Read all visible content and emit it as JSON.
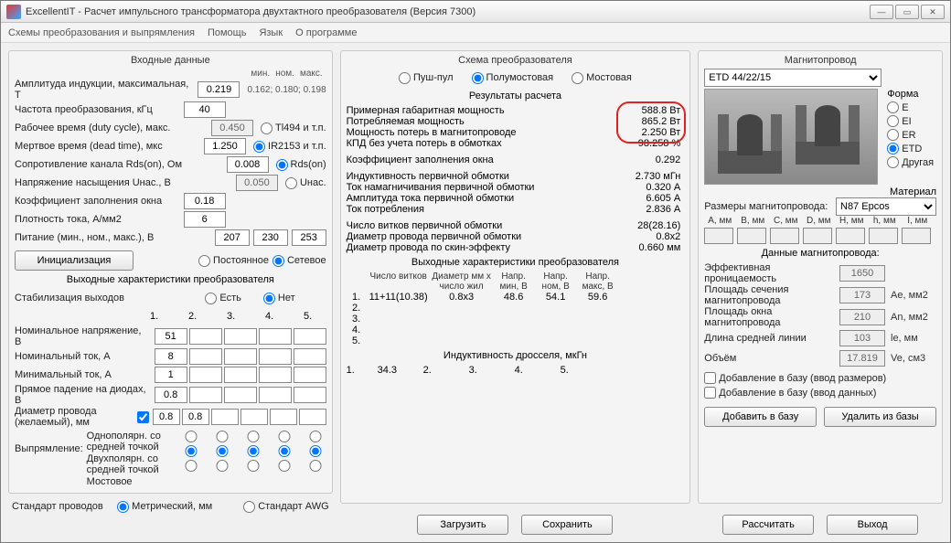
{
  "window": {
    "title": "ExcellentIT - Расчет импульсного трансформатора двухтактного преобразователя (Версия 7300)"
  },
  "menu": {
    "schematics": "Схемы преобразования и выпрямления",
    "help": "Помощь",
    "lang": "Язык",
    "about": "О программе"
  },
  "input": {
    "title": "Входные данные",
    "hdr_min": "мин.",
    "hdr_nom": "ном.",
    "hdr_max": "макс.",
    "amp_lbl": "Амплитуда индукции, максимальная, Т",
    "amp_val": "0.219",
    "amp_hint": "0.162; 0.180; 0.198",
    "freq_lbl": "Частота преобразования, кГц",
    "freq_val": "40",
    "duty_lbl": "Рабочее время (duty cycle), макс.",
    "duty_val": "0.450",
    "duty_radio": "Tl494 и т.п.",
    "dead_lbl": "Мертвое время (dead time), мкс",
    "dead_val": "1.250",
    "dead_radio": "IR2153 и т.п.",
    "rds_lbl": "Сопротивление канала Rds(on), Ом",
    "rds_val": "0.008",
    "rds_radio": "Rds(on)",
    "usat_lbl": "Напряжение насыщения Uнас., В",
    "usat_val": "0.050",
    "usat_radio": "Uнас.",
    "fill_lbl": "Коэффициент заполнения окна",
    "fill_val": "0.18",
    "dens_lbl": "Плотность тока, А/мм2",
    "dens_val": "6",
    "pwr_lbl": "Питание (мин., ном., макс.), В",
    "pwr_min": "207",
    "pwr_nom": "230",
    "pwr_max": "253",
    "init_btn": "Инициализация",
    "const_radio": "Постоянное",
    "net_radio": "Сетевое"
  },
  "output": {
    "title": "Выходные характеристики преобразователя",
    "stab_lbl": "Стабилизация выходов",
    "stab_yes": "Есть",
    "stab_no": "Нет",
    "cols": [
      "1.",
      "2.",
      "3.",
      "4.",
      "5."
    ],
    "nomv_lbl": "Номинальное напряжение, В",
    "nomv": [
      "51",
      "",
      "",
      "",
      ""
    ],
    "nomi_lbl": "Номинальный ток, А",
    "nomi": [
      "8",
      "",
      "",
      "",
      ""
    ],
    "mini_lbl": "Минимальный ток, А",
    "mini": [
      "1",
      "",
      "",
      "",
      ""
    ],
    "diode_lbl": "Прямое падение на диодах, В",
    "diode": [
      "0.8",
      "",
      "",
      "",
      ""
    ],
    "wire_lbl": "Диаметр провода (желаемый), мм",
    "wire_chk": true,
    "wire": [
      "0.8",
      "0.8",
      "",
      "",
      "",
      ""
    ],
    "rect_lbl": "Выпрямление:",
    "rect_opts": [
      "Однополярн. со средней точкой",
      "Двухполярн. со средней точкой",
      "Мостовое"
    ]
  },
  "wire_std": {
    "lbl": "Стандарт проводов",
    "metric": "Метрический, мм",
    "awg": "Стандарт AWG"
  },
  "scheme": {
    "title": "Схема преобразователя",
    "push": "Пуш-пул",
    "half": "Полумостовая",
    "bridge": "Мостовая"
  },
  "results": {
    "title": "Результаты расчета",
    "gab_lbl": "Примерная габаритная мощность",
    "gab_val": "588.8 Вт",
    "cons_lbl": "Потребляемая мощность",
    "cons_val": "865.2 Вт",
    "loss_lbl": "Мощность потерь в магнитопроводе",
    "loss_val": "2.250 Вт",
    "eff_lbl": "КПД без учета потерь в обмотках",
    "eff_val": "98.258 %",
    "kfill_lbl": "Коэффициент заполнения окна",
    "kfill_val": "0.292",
    "l1_lbl": "Индуктивность первичной обмотки",
    "l1_val": "2.730 мГн",
    "im_lbl": "Ток намагничивания первичной обмотки",
    "im_val": "0.320 А",
    "iamp_lbl": "Амплитуда тока первичной обмотки",
    "iamp_val": "6.605 А",
    "icons_lbl": "Ток потребления",
    "icons_val": "2.836 А",
    "n1_lbl": "Число витков первичной обмотки",
    "n1_val": "28(28.16)",
    "d1_lbl": "Диаметр провода первичной обмотки",
    "d1_val": "0.8x2",
    "skin_lbl": "Диаметр провода по скин-эффекту",
    "skin_val": "0.660 мм",
    "out_title": "Выходные характеристики преобразователя",
    "out_hdr": [
      "",
      "Число витков",
      "Диаметр мм x число жил",
      "Напр. мин, В",
      "Напр. ном, В",
      "Напр. макс, В"
    ],
    "out_row1": [
      "1.",
      "11+11(10.38)",
      "0.8x3",
      "48.6",
      "54.1",
      "59.6"
    ],
    "out_rows": [
      "2.",
      "3.",
      "4.",
      "5."
    ],
    "ind_title": "Индуктивность дросселя, мкГн",
    "ind_row": [
      "1.",
      "34.3",
      "2.",
      "3.",
      "4.",
      "5."
    ]
  },
  "midbtns": {
    "load": "Загрузить",
    "save": "Сохранить"
  },
  "core": {
    "title": "Магнитопровод",
    "sel": "ETD 44/22/15",
    "shape_lbl": "Форма",
    "shapes": [
      "E",
      "EI",
      "ER",
      "ETD",
      "Другая"
    ],
    "mat_lbl": "Материал",
    "mat_sel": "N87 Epcos",
    "dims_lbl": "Размеры магнитопровода:",
    "dims_hdr": [
      "A, мм",
      "B, мм",
      "C, мм",
      "D, мм",
      "H, мм",
      "h, мм",
      "I, мм"
    ],
    "data_title": "Данные магнитопровода:",
    "perm_lbl": "Эффективная проницаемость",
    "perm_val": "1650",
    "ae_lbl": "Площадь сечения магнитопровода",
    "ae_val": "173",
    "ae_unit": "Ae, мм2",
    "an_lbl": "Площадь окна магнитопровода",
    "an_val": "210",
    "an_unit": "An, мм2",
    "le_lbl": "Длина средней линии",
    "le_val": "103",
    "le_unit": "le, мм",
    "ve_lbl": "Объём",
    "ve_val": "17.819",
    "ve_unit": "Ve, см3",
    "add1": "Добавление в базу (ввод размеров)",
    "add2": "Добавление в базу (ввод данных)",
    "btn_add": "Добавить в базу",
    "btn_del": "Удалить из базы"
  },
  "rbtns": {
    "calc": "Рассчитать",
    "exit": "Выход"
  }
}
